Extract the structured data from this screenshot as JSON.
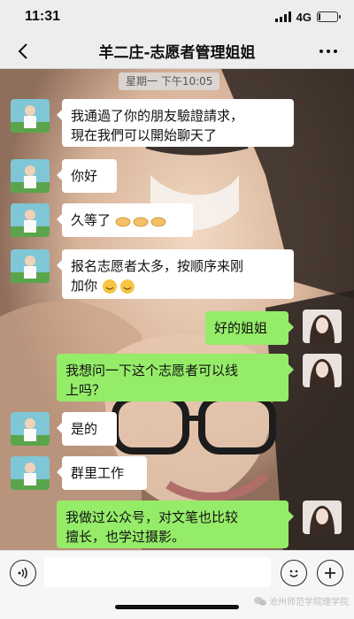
{
  "status_bar": {
    "time": "11:31",
    "network": "4G",
    "battery_level": 0.1
  },
  "nav": {
    "title": "羊二庄-志愿者管理姐姐"
  },
  "chat": {
    "timestamp": "星期一 下午10:05",
    "messages": [
      {
        "side": "in",
        "line1": "我通過了你的朋友驗證請求，",
        "line2": "現在我們可以開始聊天了"
      },
      {
        "side": "in",
        "text": "你好"
      },
      {
        "side": "in",
        "text": "久等了"
      },
      {
        "side": "in",
        "line1": "报名志愿者太多，按顺序来刚",
        "line2": "加你"
      },
      {
        "side": "out",
        "text": "好的姐姐"
      },
      {
        "side": "out",
        "line1": "我想问一下这个志愿者可以线",
        "line2": "上吗？"
      },
      {
        "side": "in",
        "text": "是的"
      },
      {
        "side": "in",
        "text": "群里工作"
      },
      {
        "side": "out",
        "line1": "我做过公众号，对文笔也比较",
        "line2": "擅长，也学过摄影。"
      }
    ],
    "emoji_icons": {
      "clap": "clapping-hands-icon",
      "smile": "smiling-face-icon"
    }
  },
  "input": {
    "placeholder": ""
  },
  "watermark": {
    "text": "沧州师范学院理学院"
  },
  "colors": {
    "outgoing_bubble": "#95ec69",
    "incoming_bubble": "#ffffff",
    "nav_background": "#ededed"
  }
}
